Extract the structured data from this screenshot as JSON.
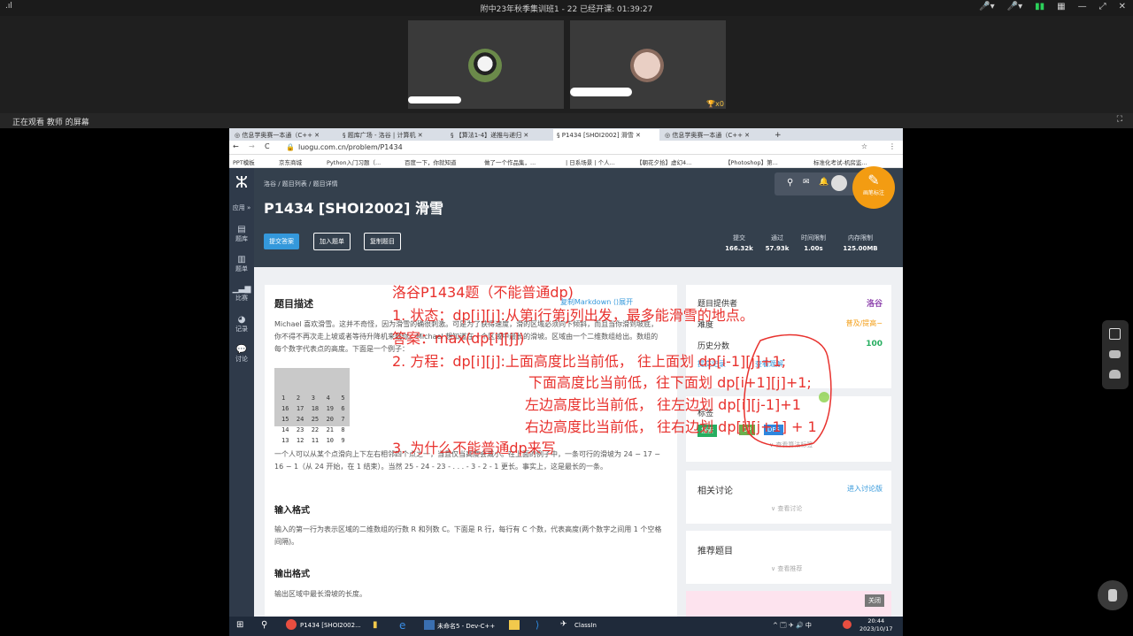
{
  "topbar": {
    "signal": ".ıl",
    "title": "附中23年秋季集训班1 - 22    已经开课: 01:39:27",
    "controls": [
      "🎤▾",
      "🎤▾",
      "▮▮",
      "▦",
      "—",
      "⤢",
      "✕"
    ]
  },
  "share_label": "正在观看 教师 的屏幕",
  "share_icon": "⛶",
  "participant_badge": "🏆x0",
  "tabs": [
    {
      "label": "◎ 信息学奥赛一本通（C++ ✕",
      "active": false
    },
    {
      "label": "§ 题库广场 - 洛谷 | 计算机 ✕",
      "active": false
    },
    {
      "label": "§ 【算法1-4】递推与递归 ✕",
      "active": false
    },
    {
      "label": "§ P1434 [SHOI2002] 滑雪 ✕",
      "active": true
    },
    {
      "label": "◎ 信息学奥赛一本通（C++ ✕",
      "active": false
    }
  ],
  "new_tab": "+",
  "url": "luogu.com.cn/problem/P1434",
  "bookmarks": [
    "PPT模板",
    "京东商城",
    "Python入门习题（...",
    "百度一下，你就知道",
    "做了一个作品集，...",
    "| 日系场景 | 个人...",
    "【朝花夕拾】虚幻4...",
    "【Photoshop】第...",
    "标准化考试-机房监..."
  ],
  "sidebar": [
    "应用 »",
    "题库",
    "题单",
    "比赛",
    "记录",
    "讨论"
  ],
  "breadcrumb": "洛谷 / 题目列表 / 题目详情",
  "problem_title": "P1434 [SHOI2002] 滑雪",
  "actions": [
    "提交答案",
    "加入题单",
    "复制题目"
  ],
  "stats": [
    {
      "label": "提交",
      "value": "166.32k"
    },
    {
      "label": "通过",
      "value": "57.93k"
    },
    {
      "label": "时间限制",
      "value": "1.00s"
    },
    {
      "label": "内存限制",
      "value": "125.00MB"
    }
  ],
  "annotate_label": "画笔标注",
  "desc_heading": "题目描述",
  "markdown_link": "复制Markdown  ⟨⟩展开",
  "desc_p1": "Michael 喜欢滑雪。这并不奇怪，因为滑雪的确很刺激。可是为了获得速度，滑的区域必须向下倾斜，而且当你滑到坡底，你不得不再次走上坡或者等待升降机来载你。Michael 想知道在一个区域中最长的滑坡。区域由一个二维数组给出。数组的每个数字代表点的高度。下面是一个例子：",
  "grid_rows": [
    "1   2   3   4   5",
    "16  17  18  19  6",
    "15  24  25  20  7",
    "14  23  22  21  8",
    "13  12  11  10  9"
  ],
  "desc_p2": "一个人可以从某个点滑向上下左右相邻四个点之一，当且仅当高度会减小。在上面的例子中，一条可行的滑坡为 24 − 17 − 16 − 1（从 24 开始，在 1 结束）。当然 25 - 24 - 23 - . . . - 3 - 2 - 1 更长。事实上，这是最长的一条。",
  "input_heading": "输入格式",
  "input_text": "输入的第一行为表示区域的二维数组的行数 R 和列数 C。下面是 R 行，每行有 C 个数，代表高度(两个数字之间用 1 个空格间隔)。",
  "output_heading": "输出格式",
  "output_text": "输出区域中最长滑坡的长度。",
  "right": {
    "provider_label": "题目提供者",
    "provider_value": "洛谷",
    "difficulty_label": "难度",
    "difficulty_value": "普及/提高−",
    "history_label": "历史分数",
    "history_value": "100",
    "record_link": "提交记录",
    "solution_link": "查看题解",
    "tags_label": "标签",
    "tags": [
      "搜索",
      "DP",
      "DFS"
    ],
    "show_tags": "∨ 查看算法标签",
    "discuss_heading": "相关讨论",
    "discuss_link": "进入讨论版",
    "discuss_more": "∨ 查看讨论",
    "recommend_heading": "推荐题目",
    "recommend_more": "∨ 查看推荐",
    "close_label": "关闭"
  },
  "annotation": {
    "line1": "洛谷P1434题（不能普通dp)",
    "line2": "1. 状态：dp[i][j]:从第i行第j列出发，最多能滑雪的地点。",
    "line3": "答案：max(dp[i][j])",
    "line4": "2. 方程：dp[i][j]:上面高度比当前低，  往上面划 dp[i-1][j]+1;",
    "line5": "下面高度比当前低，往下面划 dp[i+1][j]+1;",
    "line6": "左边高度比当前低，  往左边划 dp[i][j-1]+1",
    "line7": "右边高度比当前低，  往右边划 dp[i][j+1] + 1",
    "line8": "3. 为什么不能普通dp来写"
  },
  "taskbar": {
    "items": [
      "P1434 [SHOI2002...",
      "未命名5 - Dev-C++",
      "ClassIn"
    ],
    "tray": "^ 🗔 ✈ 🔊 中",
    "time": "20:44",
    "date": "2023/10/17"
  },
  "colors": {
    "accent": "#3498db",
    "ink": "#e8322e",
    "hero": "#34404d",
    "sidebar": "#2f3a4a"
  }
}
